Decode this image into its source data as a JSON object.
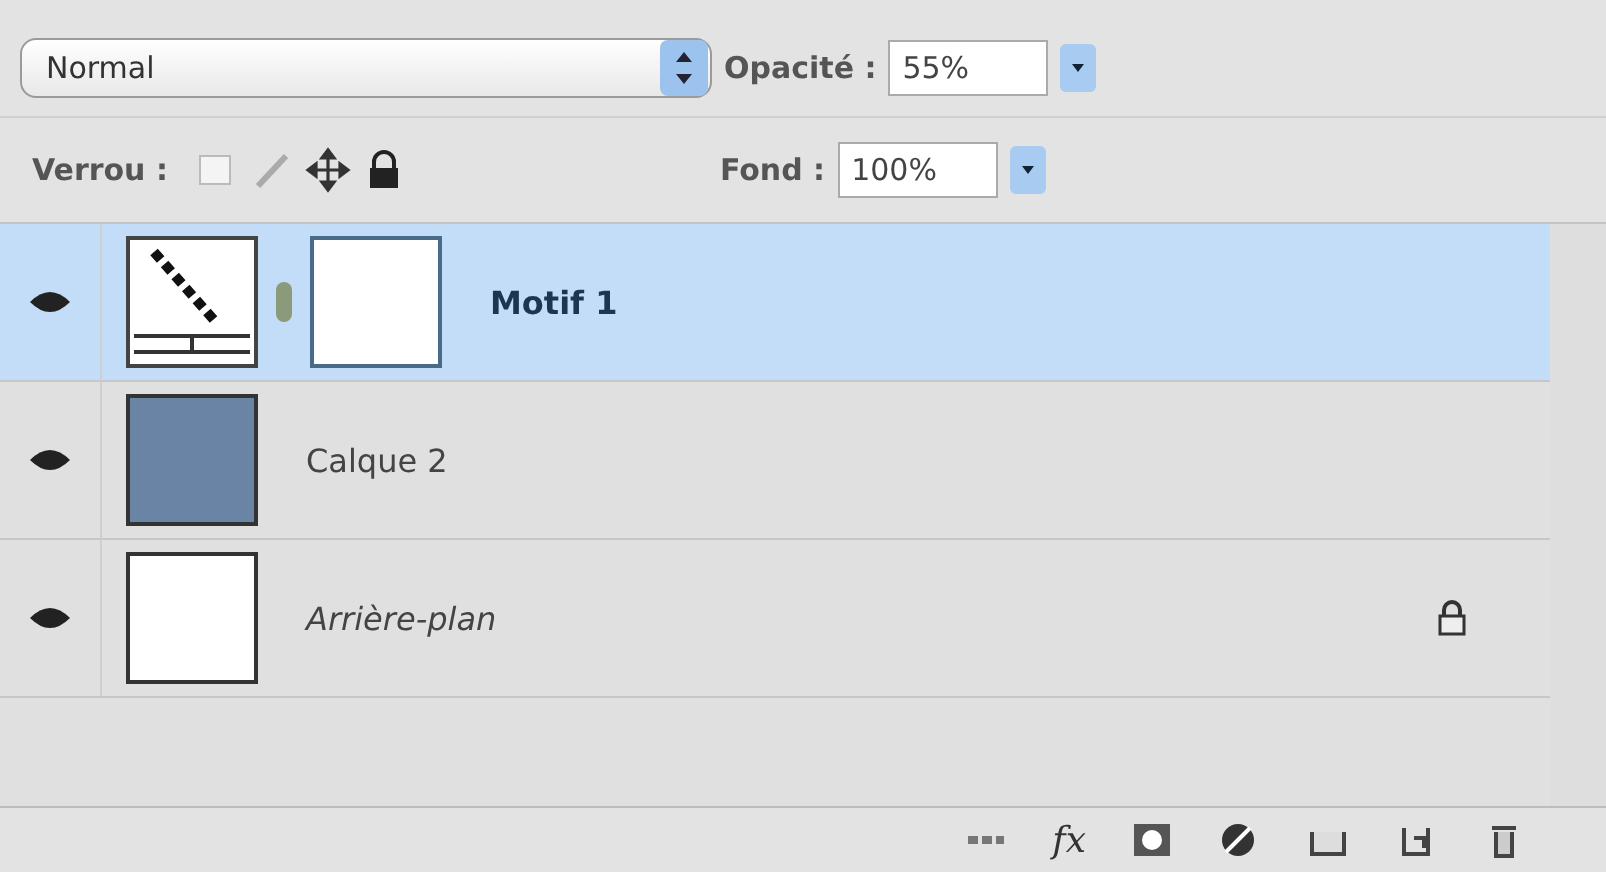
{
  "blend_mode": {
    "value": "Normal"
  },
  "opacity": {
    "label": "Opacité :",
    "value": "55%"
  },
  "lock": {
    "label": "Verrou :"
  },
  "fill": {
    "label": "Fond :",
    "value": "100%"
  },
  "layers": [
    {
      "name": "Motif 1",
      "selected": true,
      "visible": true,
      "kind": "fill",
      "locked": false
    },
    {
      "name": "Calque 2",
      "selected": false,
      "visible": true,
      "kind": "color",
      "color": "#6a84a6",
      "locked": false
    },
    {
      "name": "Arrière-plan",
      "selected": false,
      "visible": true,
      "kind": "background",
      "locked": true
    }
  ],
  "footer": {
    "effects_label": "fx"
  }
}
